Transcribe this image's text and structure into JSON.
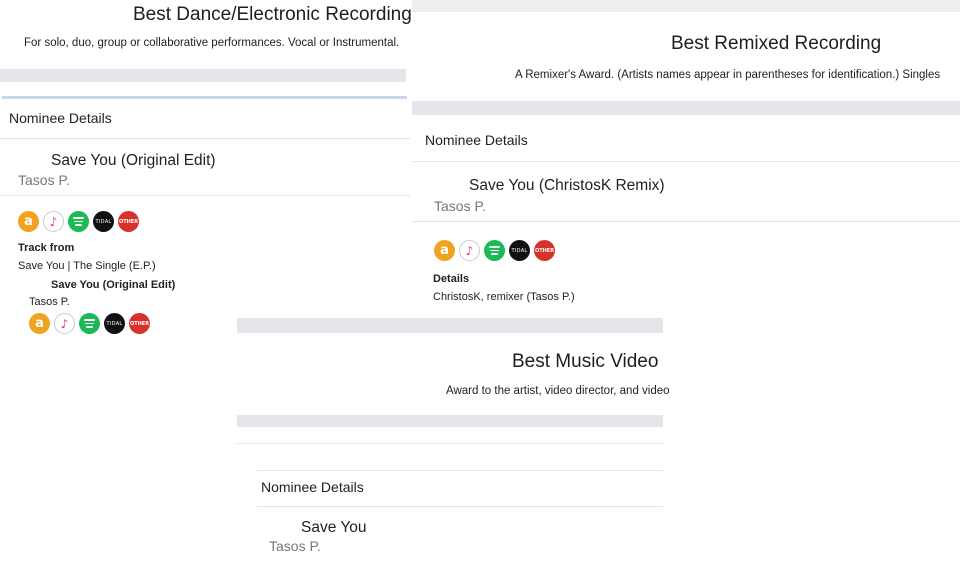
{
  "screenshot_1": {
    "category_title": "Best Dance/Electronic Recording",
    "category_desc": "For solo, duo, group or collaborative performances. Vocal or Instrumental.",
    "nominee_details_label": "Nominee Details",
    "track_title": "Save You (Original Edit)",
    "artist": "Tasos P.",
    "track_from_label": "Track from",
    "album": "Save You | The Single (E.P.)",
    "sub_track_title": "Save You (Original Edit)",
    "sub_artist": "Tasos P."
  },
  "screenshot_2": {
    "category_title": "Best Remixed Recording",
    "category_desc": "A Remixer's Award. (Artists names appear in parentheses for identification.) Singles",
    "nominee_details_label": "Nominee Details",
    "track_title": "Save You (ChristosK Remix)",
    "artist": "Tasos P.",
    "details_label": "Details",
    "details_text": "ChristosK, remixer (Tasos P.)"
  },
  "screenshot_3": {
    "category_title": "Best Music Video",
    "category_desc": "Award to the artist, video director, and video",
    "nominee_details_label": "Nominee Details",
    "track_title": "Save You",
    "artist": "Tasos P."
  },
  "service_icons": {
    "amazon": "a",
    "itunes": "♪",
    "tidal": "TIDAL",
    "other": "OTHER"
  },
  "colors": {
    "amazon": "#f0a320",
    "itunes": "#e0407a",
    "spotify": "#1db954",
    "tidal": "#111111",
    "other": "#d6322b",
    "separator": "#e4e6e9",
    "accent_line": "#c5d8ec"
  }
}
